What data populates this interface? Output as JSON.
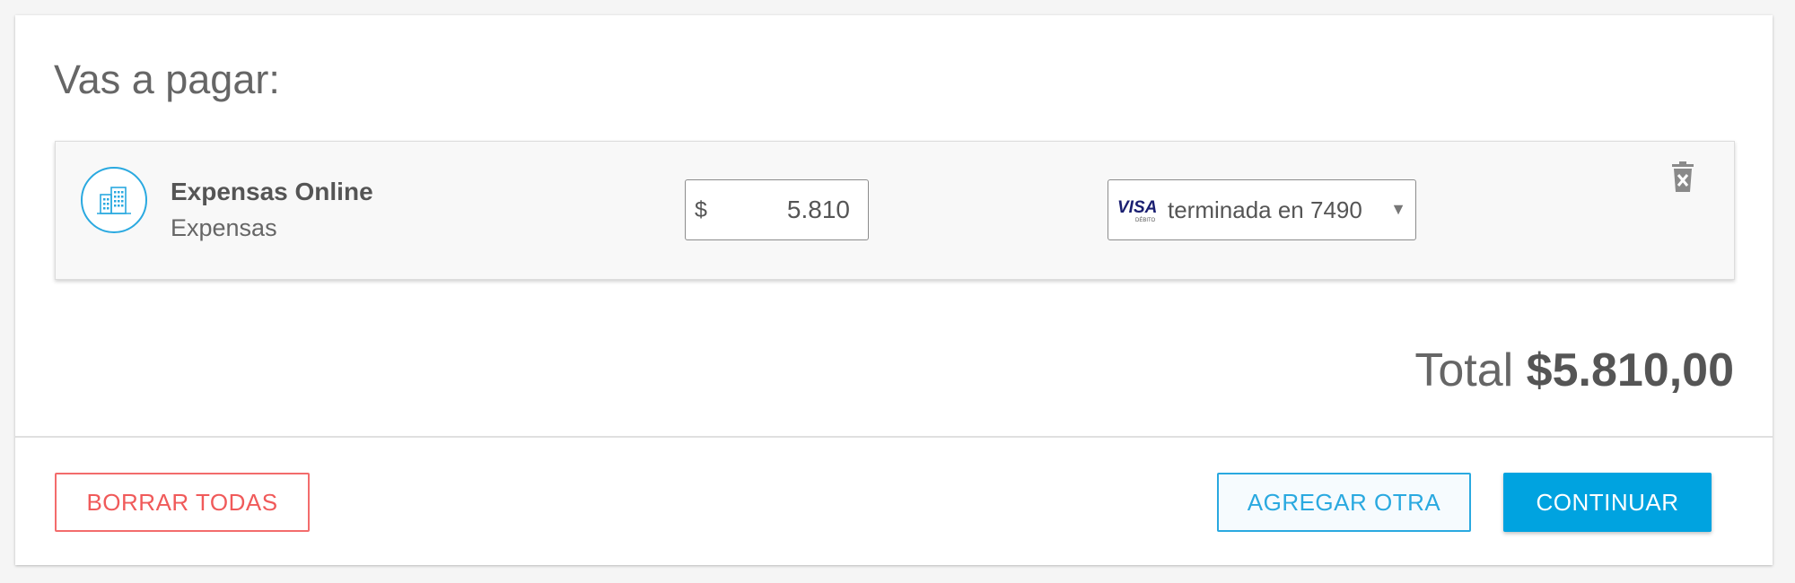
{
  "header": {
    "title": "Vas a pagar:"
  },
  "item": {
    "icon": "building-icon",
    "name": "Expensas Online",
    "type": "Expensas",
    "currency": "$",
    "amount": "5.810",
    "payment_card": {
      "brand_logo": "VISA",
      "brand_sublabel": "DÉBITO",
      "label": "terminada en 7490"
    },
    "delete_icon": "trash-icon"
  },
  "summary": {
    "total_label": "Total",
    "total_value": "$5.810,00"
  },
  "actions": {
    "clear_all_label": "BORRAR TODAS",
    "add_another_label": "AGREGAR OTRA",
    "continue_label": "CONTINUAR"
  },
  "colors": {
    "accent": "#00a3e0",
    "danger": "#f05a5a",
    "text": "#555555"
  }
}
